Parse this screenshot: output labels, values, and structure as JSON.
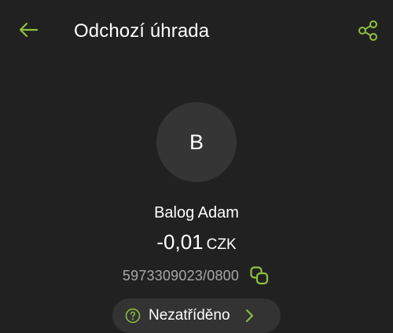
{
  "header": {
    "title": "Odchozí úhrada",
    "back_icon": "arrow-left-icon",
    "share_icon": "share-icon"
  },
  "contact": {
    "avatar_initial": "B",
    "name": "Balog Adam",
    "amount": "-0,01",
    "currency": "CZK",
    "account_number": "5973309023/0800",
    "copy_icon": "copy-icon"
  },
  "category": {
    "label": "Nezatříděno",
    "icon": "question-circle-icon",
    "chevron_icon": "chevron-right-icon"
  },
  "colors": {
    "background": "#212121",
    "accent": "#8fc13e",
    "avatar_bg": "#353535",
    "chip_bg": "#333333",
    "secondary_text": "#a8a8a8"
  }
}
